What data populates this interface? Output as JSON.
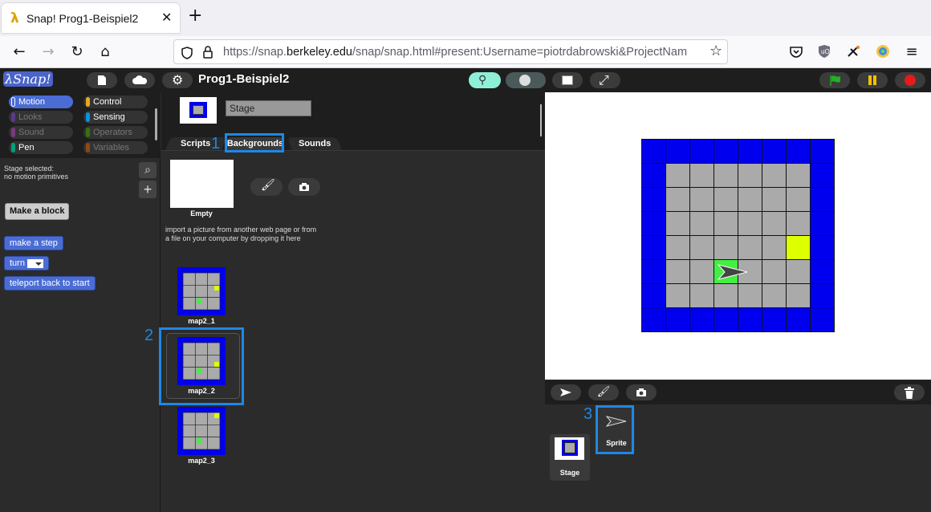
{
  "browser": {
    "tab_title": "Snap! Prog1-Beispiel2",
    "close_glyph": "✕",
    "new_tab_glyph": "+",
    "url_prefix": "https://snap.",
    "url_domain": "berkeley.edu",
    "url_suffix": "/snap/snap.html#present:Username=piotrdabrowski&ProjectNam"
  },
  "snap": {
    "logo": "λSnap!",
    "project_title": "Prog1-Beispiel2",
    "categories": [
      {
        "label": "Motion",
        "color": "#4a6cd4",
        "active": true
      },
      {
        "label": "Control",
        "color": "#e6a822",
        "active": false
      },
      {
        "label": "Looks",
        "color": "#8a55d7",
        "active": false
      },
      {
        "label": "Sensing",
        "color": "#0494dc",
        "active": false
      },
      {
        "label": "Sound",
        "color": "#cf4ad9",
        "active": false
      },
      {
        "label": "Operators",
        "color": "#62c213",
        "active": false
      },
      {
        "label": "Pen",
        "color": "#00a178",
        "active": false
      },
      {
        "label": "Variables",
        "color": "#f3761d",
        "active": false
      }
    ],
    "palette_note_line1": "Stage selected:",
    "palette_note_line2": "no motion primitives",
    "make_block_label": "Make a block",
    "blocks": [
      "make a step",
      "turn",
      "teleport back to start"
    ],
    "stage_name": "Stage",
    "tabs": {
      "scripts": "Scripts",
      "backgrounds": "Backgrounds",
      "sounds": "Sounds"
    },
    "empty_label": "Empty",
    "import_hint_line1": "import a picture from another web page or from",
    "import_hint_line2": "a file on your computer by dropping it here",
    "costumes": [
      "map2_1",
      "map2_2",
      "map2_3"
    ],
    "corral_sprite": "Sprite",
    "corral_stage": "Stage"
  },
  "annotations": [
    "1",
    "2",
    "3"
  ],
  "colors": {
    "wall": "#0000ee",
    "floor": "#aaaaaa",
    "goal": "#ddff00",
    "start": "#44ee44",
    "accent": "#1e88e5"
  }
}
